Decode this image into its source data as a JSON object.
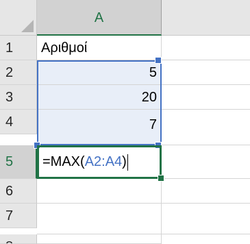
{
  "column_header": {
    "label": "A"
  },
  "row_headers": [
    "1",
    "2",
    "3",
    "4",
    "5",
    "6",
    "7",
    "8"
  ],
  "cells": {
    "A1": "Αριθμοί",
    "A2": "5",
    "A3": "20",
    "A4": "7"
  },
  "formula": {
    "prefix": "=MAX(",
    "range": "A2:A4",
    "suffix": ")"
  },
  "colors": {
    "active_green": "#217346",
    "reference_blue": "#4472c4",
    "reference_fill": "#e8eef8"
  }
}
